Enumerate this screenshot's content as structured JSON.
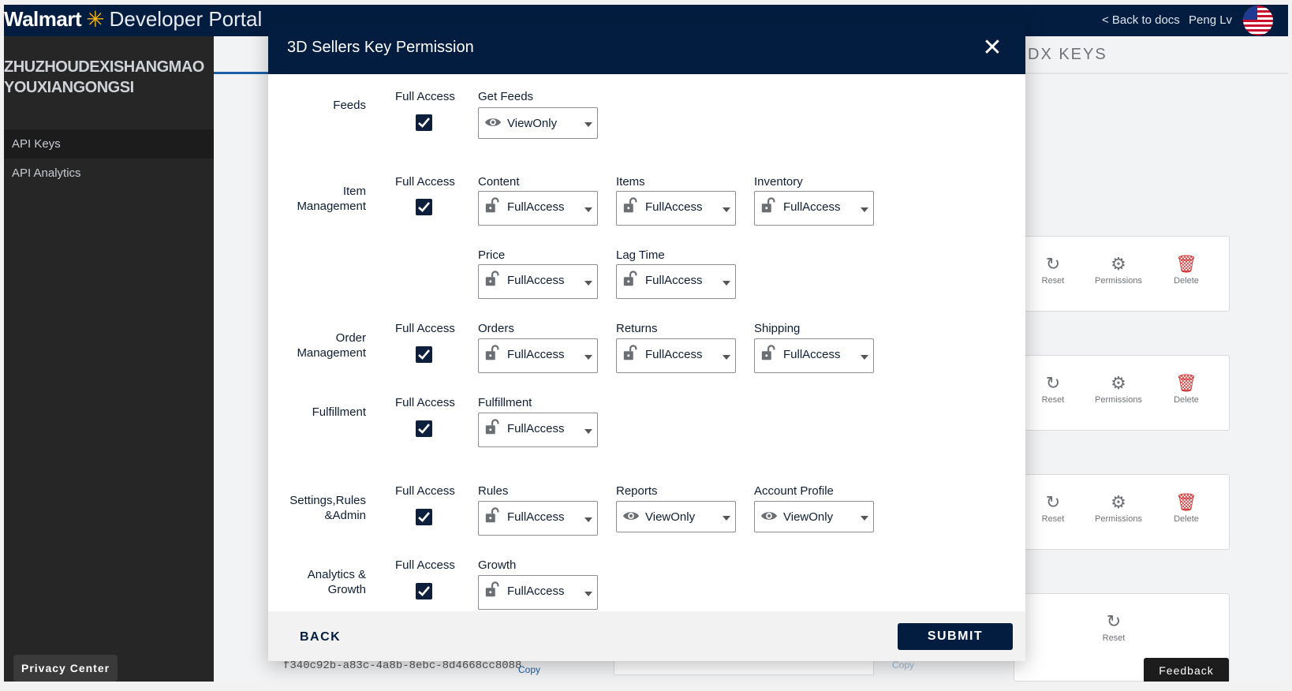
{
  "topbar": {
    "brand": "Walmart",
    "portal": "Developer Portal",
    "back_to_docs": "< Back to docs",
    "user_name": "Peng Lv"
  },
  "sidebar": {
    "company_line1": "ZHUZHOUDEXISHANGMAO",
    "company_line2": "YOUXIANGONGSI",
    "items": [
      {
        "label": "API Keys"
      },
      {
        "label": "API Analytics"
      }
    ],
    "privacy_center": "Privacy Center"
  },
  "background": {
    "tab_partial": "DX KEYS",
    "actions": {
      "reset": "Reset",
      "permissions": "Permissions",
      "delete": "Delete"
    },
    "key_partial": "f340c92b-a83c-4a8b-8ebc-8d4668cc8088",
    "copy": "Copy",
    "feedback": "Feedback"
  },
  "modal": {
    "title": "3D Sellers Key Permission",
    "back_label": "BACK",
    "submit_label": "SUBMIT",
    "full_access_label": "Full Access",
    "groups": {
      "feeds": {
        "label": "Feeds",
        "full_access": true,
        "fields": {
          "get_feeds": {
            "label": "Get Feeds",
            "value": "ViewOnly",
            "icon": "eye-icon"
          }
        }
      },
      "item_management": {
        "label_line1": "Item",
        "label_line2": "Management",
        "full_access": true,
        "fields": {
          "content": {
            "label": "Content",
            "value": "FullAccess",
            "icon": "unlock-icon"
          },
          "items": {
            "label": "Items",
            "value": "FullAccess",
            "icon": "unlock-icon"
          },
          "inventory": {
            "label": "Inventory",
            "value": "FullAccess",
            "icon": "unlock-icon"
          },
          "price": {
            "label": "Price",
            "value": "FullAccess",
            "icon": "unlock-icon"
          },
          "lag_time": {
            "label": "Lag Time",
            "value": "FullAccess",
            "icon": "unlock-icon"
          }
        }
      },
      "order_management": {
        "label_line1": "Order",
        "label_line2": "Management",
        "full_access": true,
        "fields": {
          "orders": {
            "label": "Orders",
            "value": "FullAccess",
            "icon": "unlock-icon"
          },
          "returns": {
            "label": "Returns",
            "value": "FullAccess",
            "icon": "unlock-icon"
          },
          "shipping": {
            "label": "Shipping",
            "value": "FullAccess",
            "icon": "unlock-icon"
          }
        }
      },
      "fulfillment": {
        "label": "Fulfillment",
        "full_access": true,
        "fields": {
          "fulfillment": {
            "label": "Fulfillment",
            "value": "FullAccess",
            "icon": "unlock-icon"
          }
        }
      },
      "settings": {
        "label_line1": "Settings,Rules",
        "label_line2": "&Admin",
        "full_access": true,
        "fields": {
          "rules": {
            "label": "Rules",
            "value": "FullAccess",
            "icon": "unlock-icon"
          },
          "reports": {
            "label": "Reports",
            "value": "ViewOnly",
            "icon": "eye-icon"
          },
          "account_profile": {
            "label": "Account Profile",
            "value": "ViewOnly",
            "icon": "eye-icon"
          }
        }
      },
      "analytics": {
        "label_line1": "Analytics &",
        "label_line2": "Growth",
        "full_access": true,
        "fields": {
          "growth": {
            "label": "Growth",
            "value": "FullAccess",
            "icon": "unlock-icon"
          }
        }
      }
    }
  },
  "colors": {
    "navy": "#031d40",
    "spark": "#f9b50e",
    "delete_red": "#d32f2f",
    "sidebar": "#262626"
  }
}
